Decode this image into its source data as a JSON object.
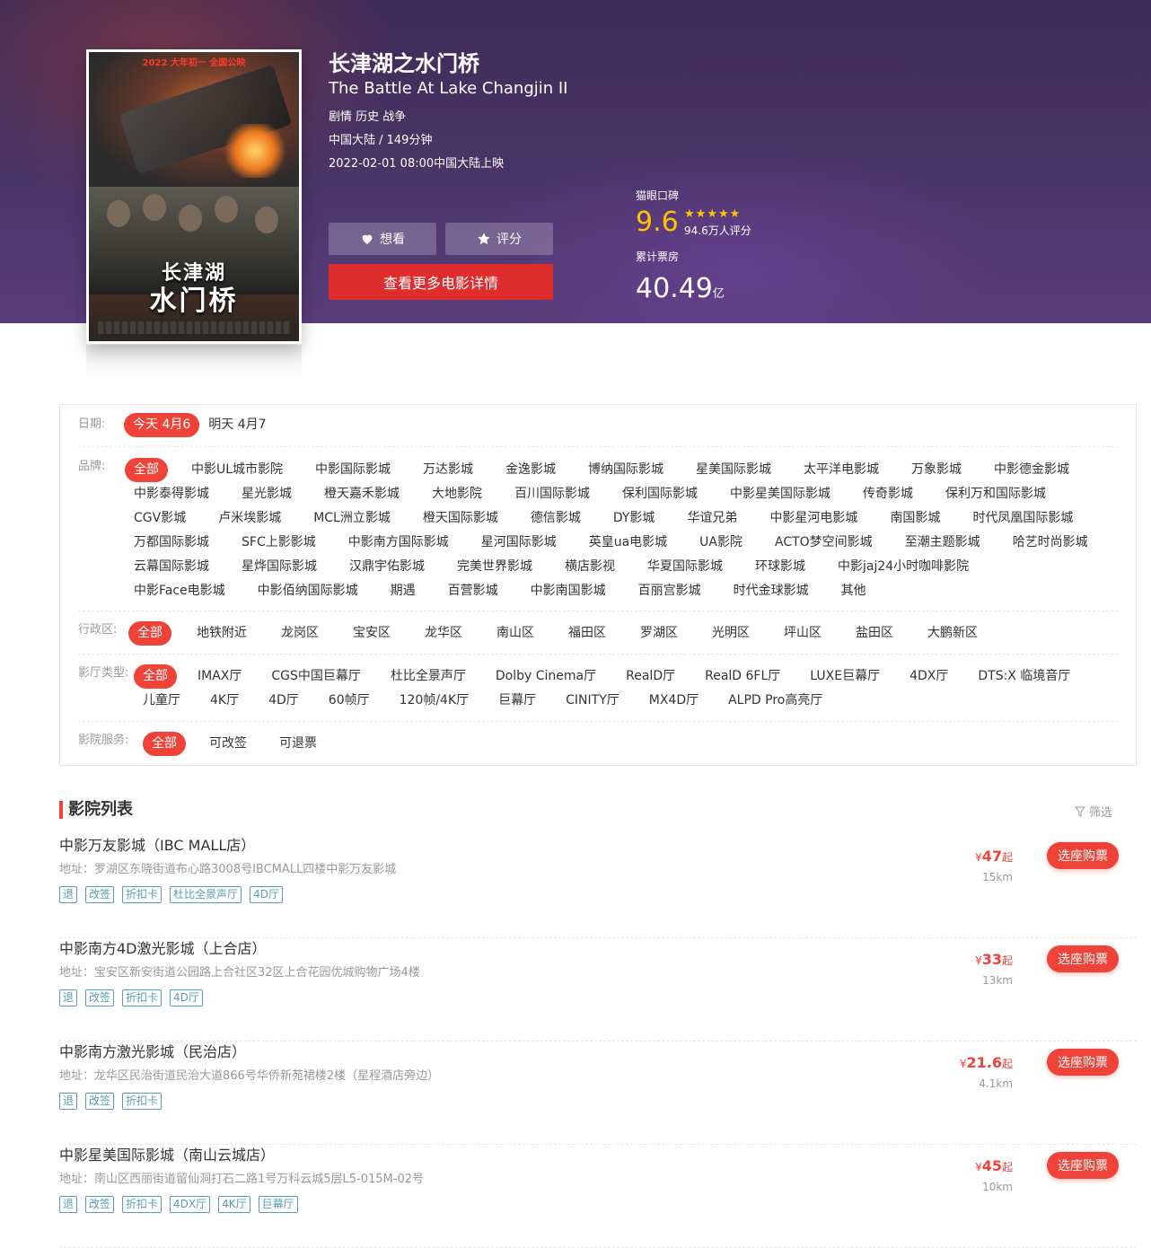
{
  "movie": {
    "poster_top_text": "2022 大年初一 全国公映",
    "poster_title_1": "长津湖",
    "poster_title_2": "水门桥",
    "title_cn": "长津湖之水门桥",
    "title_en": "The Battle At Lake Changjin II",
    "genres": "剧情 历史 战争",
    "region_duration": "中国大陆 / 149分钟",
    "release": "2022-02-01 08:00中国大陆上映",
    "want_label": "想看",
    "rate_label": "评分",
    "detail_button": "查看更多电影详情",
    "rating_label": "猫眼口碑",
    "rating_score": "9.6",
    "rating_stars": 5,
    "rating_count": "94.6万人评分",
    "boxoffice_label": "累计票房",
    "boxoffice_value": "40.49",
    "boxoffice_unit": "亿"
  },
  "filters": {
    "date": {
      "label": "日期:",
      "items": [
        "今天 4月6",
        "明天 4月7"
      ],
      "active": 0
    },
    "brand": {
      "label": "品牌:",
      "items": [
        "全部",
        "中影UL城市影院",
        "中影国际影城",
        "万达影城",
        "金逸影城",
        "博纳国际影城",
        "星美国际影城",
        "太平洋电影城",
        "万象影城",
        "中影德金影城",
        "中影泰得影城",
        "星光影城",
        "橙天嘉禾影城",
        "大地影院",
        "百川国际影城",
        "保利国际影城",
        "中影星美国际影城",
        "传奇影城",
        "保利万和国际影城",
        "CGV影城",
        "卢米埃影城",
        "MCL洲立影城",
        "橙天国际影城",
        "德信影城",
        "DY影城",
        "华谊兄弟",
        "中影星河电影城",
        "南国影城",
        "时代凤凰国际影城",
        "万都国际影城",
        "SFC上影影城",
        "中影南方国际影城",
        "星河国际影城",
        "英皇ua电影城",
        "UA影院",
        "ACTO梦空间影城",
        "至潮主题影城",
        "哈艺时尚影城",
        "云幕国际影城",
        "星烨国际影城",
        "汉鼎宇佑影城",
        "完美世界影城",
        "横店影视",
        "华夏国际影城",
        "环球影城",
        "中影jaj24小时咖啡影院",
        "中影Face电影城",
        "中影佰纳国际影城",
        "期遇",
        "百营影城",
        "中影南国影城",
        "百丽宫影城",
        "时代金球影城",
        "其他"
      ],
      "active": 0
    },
    "district": {
      "label": "行政区:",
      "items": [
        "全部",
        "地铁附近",
        "龙岗区",
        "宝安区",
        "龙华区",
        "南山区",
        "福田区",
        "罗湖区",
        "光明区",
        "坪山区",
        "盐田区",
        "大鹏新区"
      ],
      "active": 0
    },
    "hall": {
      "label": "影厅类型:",
      "items": [
        "全部",
        "IMAX厅",
        "CGS中国巨幕厅",
        "杜比全景声厅",
        "Dolby Cinema厅",
        "RealD厅",
        "RealD 6FL厅",
        "LUXE巨幕厅",
        "4DX厅",
        "DTS:X 临境音厅",
        "儿童厅",
        "4K厅",
        "4D厅",
        "60帧厅",
        "120帧/4K厅",
        "巨幕厅",
        "CINITY厅",
        "MX4D厅",
        "ALPD Pro高亮厅"
      ],
      "active": 0
    },
    "service": {
      "label": "影院服务:",
      "items": [
        "全部",
        "可改签",
        "可退票"
      ],
      "active": 0
    }
  },
  "cinema_list": {
    "title": "影院列表",
    "filter_label": "筛选",
    "buy_label": "选座购票",
    "currency": "¥",
    "price_suffix": "起",
    "items": [
      {
        "name": "中影万友影城（IBC MALL店）",
        "address": "地址：罗湖区东晓街道布心路3008号IBCMALL四楼中影万友影城",
        "tags": [
          "退",
          "改签",
          "折扣卡",
          "杜比全景声厅",
          "4D厅"
        ],
        "price": "47",
        "distance": "15km"
      },
      {
        "name": "中影南方4D激光影城（上合店）",
        "address": "地址：宝安区新安街道公园路上合社区32区上合花园优城购物广场4楼",
        "tags": [
          "退",
          "改签",
          "折扣卡",
          "4D厅"
        ],
        "price": "33",
        "distance": "13km"
      },
      {
        "name": "中影南方激光影城（民治店）",
        "address": "地址：龙华区民治街道民治大道866号华侨新苑裙楼2楼（星程酒店旁边）",
        "tags": [
          "退",
          "改签",
          "折扣卡"
        ],
        "price": "21.6",
        "distance": "4.1km"
      },
      {
        "name": "中影星美国际影城（南山云城店）",
        "address": "地址：南山区西丽街道留仙洞打石二路1号万科云城5层L5-015M-02号",
        "tags": [
          "退",
          "改签",
          "折扣卡",
          "4DX厅",
          "4K厅",
          "巨幕厅"
        ],
        "price": "45",
        "distance": "10km"
      }
    ]
  },
  "colors": {
    "accent": "#ef4238",
    "tag": "#589daf",
    "star": "#ffc600"
  }
}
